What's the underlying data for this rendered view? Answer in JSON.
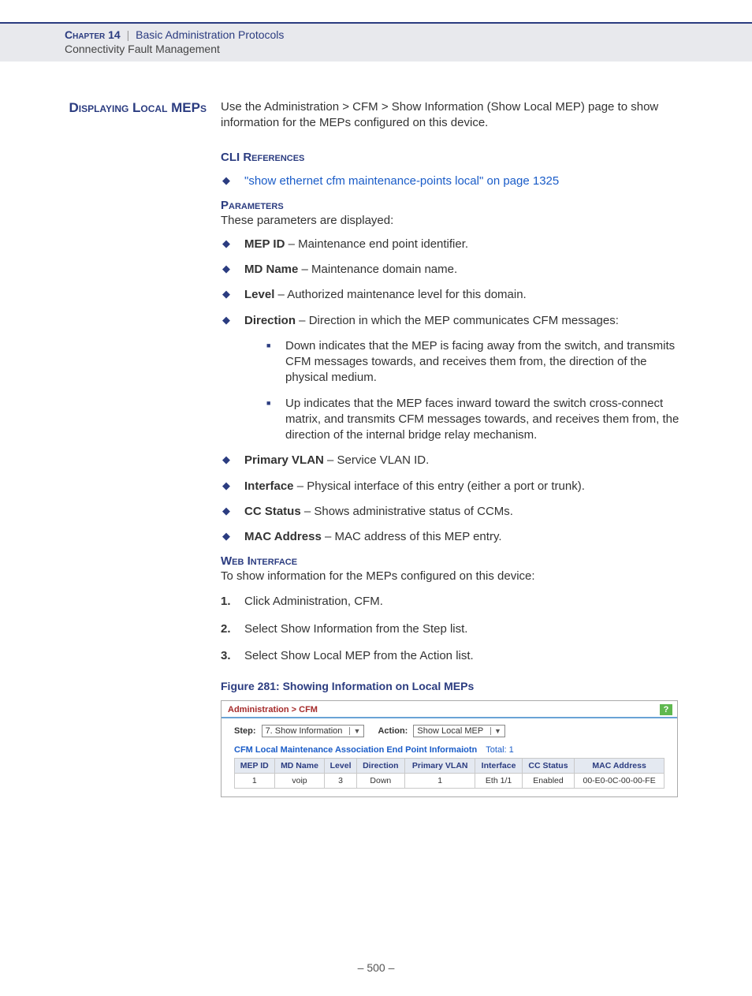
{
  "header": {
    "chapter": "Chapter 14",
    "divider": "|",
    "section": "Basic Administration Protocols",
    "sub": "Connectivity Fault Management"
  },
  "side": {
    "title": "Displaying Local MEPs"
  },
  "lead": "Use the Administration > CFM > Show Information (Show Local MEP) page to show information for the MEPs configured on this device.",
  "cli": {
    "head": "CLI References",
    "link": "\"show ethernet cfm maintenance-points local\" on page 1325"
  },
  "params": {
    "head": "Parameters",
    "intro": "These parameters are displayed:",
    "list": [
      {
        "label": "MEP ID",
        "desc": " – Maintenance end point identifier."
      },
      {
        "label": "MD Name",
        "desc": " – Maintenance domain name."
      },
      {
        "label": "Level",
        "desc": " – Authorized maintenance level for this domain."
      },
      {
        "label": "Direction",
        "desc": " – Direction in which the MEP communicates CFM messages:",
        "sub": [
          "Down indicates that the MEP is facing away from the switch, and transmits CFM messages towards, and receives them from, the direction of the physical medium.",
          "Up indicates that the MEP faces inward toward the switch cross-connect matrix, and transmits CFM messages towards, and receives them from, the direction of the internal bridge relay mechanism."
        ]
      },
      {
        "label": "Primary VLAN",
        "desc": " – Service VLAN ID."
      },
      {
        "label": "Interface",
        "desc": " – Physical interface of this entry (either a port or trunk)."
      },
      {
        "label": "CC Status",
        "desc": " – Shows administrative status of CCMs."
      },
      {
        "label": "MAC Address",
        "desc": " – MAC address of this MEP entry."
      }
    ]
  },
  "web": {
    "head": "Web Interface",
    "intro": "To show information for the MEPs configured on this device:",
    "steps": [
      "Click Administration, CFM.",
      "Select Show Information from the Step list.",
      "Select Show Local MEP from the Action list."
    ]
  },
  "figure": {
    "cap": "Figure 281:  Showing Information on Local MEPs"
  },
  "ss": {
    "breadcrumb": "Administration > CFM",
    "help": "?",
    "step_label": "Step:",
    "step_value": "7. Show Information",
    "action_label": "Action:",
    "action_value": "Show Local MEP",
    "list_title": "CFM Local Maintenance Association End Point Informaiotn",
    "total": "Total: 1",
    "columns": [
      "MEP ID",
      "MD Name",
      "Level",
      "Direction",
      "Primary VLAN",
      "Interface",
      "CC Status",
      "MAC Address"
    ],
    "rows": [
      [
        "1",
        "voip",
        "3",
        "Down",
        "1",
        "Eth 1/1",
        "Enabled",
        "00-E0-0C-00-00-FE"
      ]
    ]
  },
  "page_num": "–  500  –"
}
